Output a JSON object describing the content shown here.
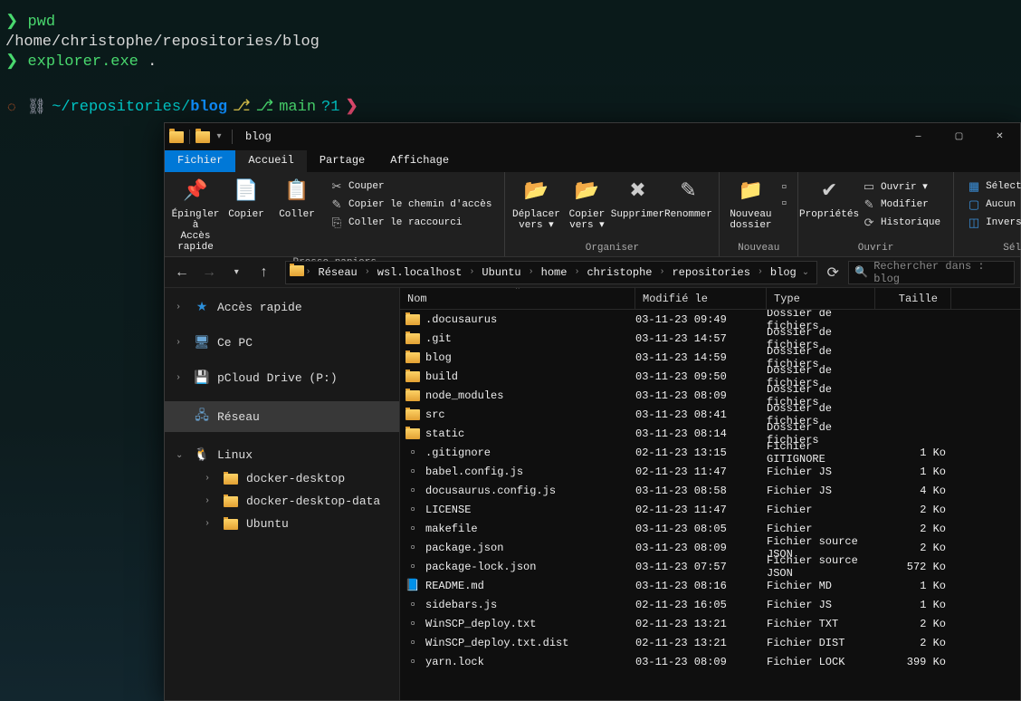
{
  "terminal": {
    "prompt1": "❯ ",
    "cmd1": "pwd",
    "out1": "/home/christophe/repositories/blog",
    "prompt2": "❯ ",
    "cmd2": "explorer.exe",
    "cmd2_arg": " .",
    "status_path_prefix": " ~/repositories/",
    "status_path_last": "blog",
    "branch_symbol": "",
    "branch": "main",
    "dirty": "?1",
    "arrow": "❯"
  },
  "window": {
    "title": "blog",
    "tabs": {
      "file": "Fichier",
      "home": "Accueil",
      "share": "Partage",
      "view": "Affichage"
    }
  },
  "ribbon": {
    "clipboard": {
      "pin": "Épingler à\nAccès rapide",
      "copy": "Copier",
      "paste": "Coller",
      "cut": "Couper",
      "copy_path": "Copier le chemin d'accès",
      "paste_shortcut": "Coller le raccourci",
      "label": "Presse-papiers"
    },
    "organize": {
      "move": "Déplacer\nvers ▾",
      "copy_to": "Copier\nvers ▾",
      "delete": "Supprimer",
      "rename": "Renommer",
      "label": "Organiser"
    },
    "new": {
      "new_folder": "Nouveau\ndossier",
      "label": "Nouveau"
    },
    "open": {
      "properties": "Propriétés",
      "open": "Ouvrir ▾",
      "edit": "Modifier",
      "history": "Historique",
      "label": "Ouvrir"
    },
    "select": {
      "all": "Sélectionner tout",
      "none": "Aucun",
      "invert": "Inverser la sélection",
      "label": "Sélectionner"
    }
  },
  "breadcrumbs": [
    "Réseau",
    "wsl.localhost",
    "Ubuntu",
    "home",
    "christophe",
    "repositories",
    "blog"
  ],
  "search": {
    "placeholder": "Rechercher dans : blog"
  },
  "navpane": {
    "quick": "Accès rapide",
    "pc": "Ce PC",
    "pcloud": "pCloud Drive (P:)",
    "network": "Réseau",
    "linux": "Linux",
    "linux_children": [
      "docker-desktop",
      "docker-desktop-data",
      "Ubuntu"
    ]
  },
  "columns": {
    "name": "Nom",
    "modified": "Modifié le",
    "type": "Type",
    "size": "Taille"
  },
  "rows": [
    {
      "icon": "folder",
      "name": ".docusaurus",
      "modified": "03-11-23 09:49",
      "type": "Dossier de fichiers",
      "size": ""
    },
    {
      "icon": "folder",
      "name": ".git",
      "modified": "03-11-23 14:57",
      "type": "Dossier de fichiers",
      "size": ""
    },
    {
      "icon": "folder",
      "name": "blog",
      "modified": "03-11-23 14:59",
      "type": "Dossier de fichiers",
      "size": ""
    },
    {
      "icon": "folder",
      "name": "build",
      "modified": "03-11-23 09:50",
      "type": "Dossier de fichiers",
      "size": ""
    },
    {
      "icon": "folder",
      "name": "node_modules",
      "modified": "03-11-23 08:09",
      "type": "Dossier de fichiers",
      "size": ""
    },
    {
      "icon": "folder",
      "name": "src",
      "modified": "03-11-23 08:41",
      "type": "Dossier de fichiers",
      "size": ""
    },
    {
      "icon": "folder",
      "name": "static",
      "modified": "03-11-23 08:14",
      "type": "Dossier de fichiers",
      "size": ""
    },
    {
      "icon": "file",
      "name": ".gitignore",
      "modified": "02-11-23 13:15",
      "type": "Fichier GITIGNORE",
      "size": "1 Ko"
    },
    {
      "icon": "file",
      "name": "babel.config.js",
      "modified": "02-11-23 11:47",
      "type": "Fichier JS",
      "size": "1 Ko"
    },
    {
      "icon": "file",
      "name": "docusaurus.config.js",
      "modified": "03-11-23 08:58",
      "type": "Fichier JS",
      "size": "4 Ko"
    },
    {
      "icon": "file",
      "name": "LICENSE",
      "modified": "02-11-23 11:47",
      "type": "Fichier",
      "size": "2 Ko"
    },
    {
      "icon": "file",
      "name": "makefile",
      "modified": "03-11-23 08:05",
      "type": "Fichier",
      "size": "2 Ko"
    },
    {
      "icon": "file",
      "name": "package.json",
      "modified": "03-11-23 08:09",
      "type": "Fichier source JSON",
      "size": "2 Ko"
    },
    {
      "icon": "file",
      "name": "package-lock.json",
      "modified": "03-11-23 07:57",
      "type": "Fichier source JSON",
      "size": "572 Ko"
    },
    {
      "icon": "md",
      "name": "README.md",
      "modified": "03-11-23 08:16",
      "type": "Fichier MD",
      "size": "1 Ko"
    },
    {
      "icon": "file",
      "name": "sidebars.js",
      "modified": "02-11-23 16:05",
      "type": "Fichier JS",
      "size": "1 Ko"
    },
    {
      "icon": "file",
      "name": "WinSCP_deploy.txt",
      "modified": "02-11-23 13:21",
      "type": "Fichier TXT",
      "size": "2 Ko"
    },
    {
      "icon": "file",
      "name": "WinSCP_deploy.txt.dist",
      "modified": "02-11-23 13:21",
      "type": "Fichier DIST",
      "size": "2 Ko"
    },
    {
      "icon": "file",
      "name": "yarn.lock",
      "modified": "03-11-23 08:09",
      "type": "Fichier LOCK",
      "size": "399 Ko"
    }
  ]
}
